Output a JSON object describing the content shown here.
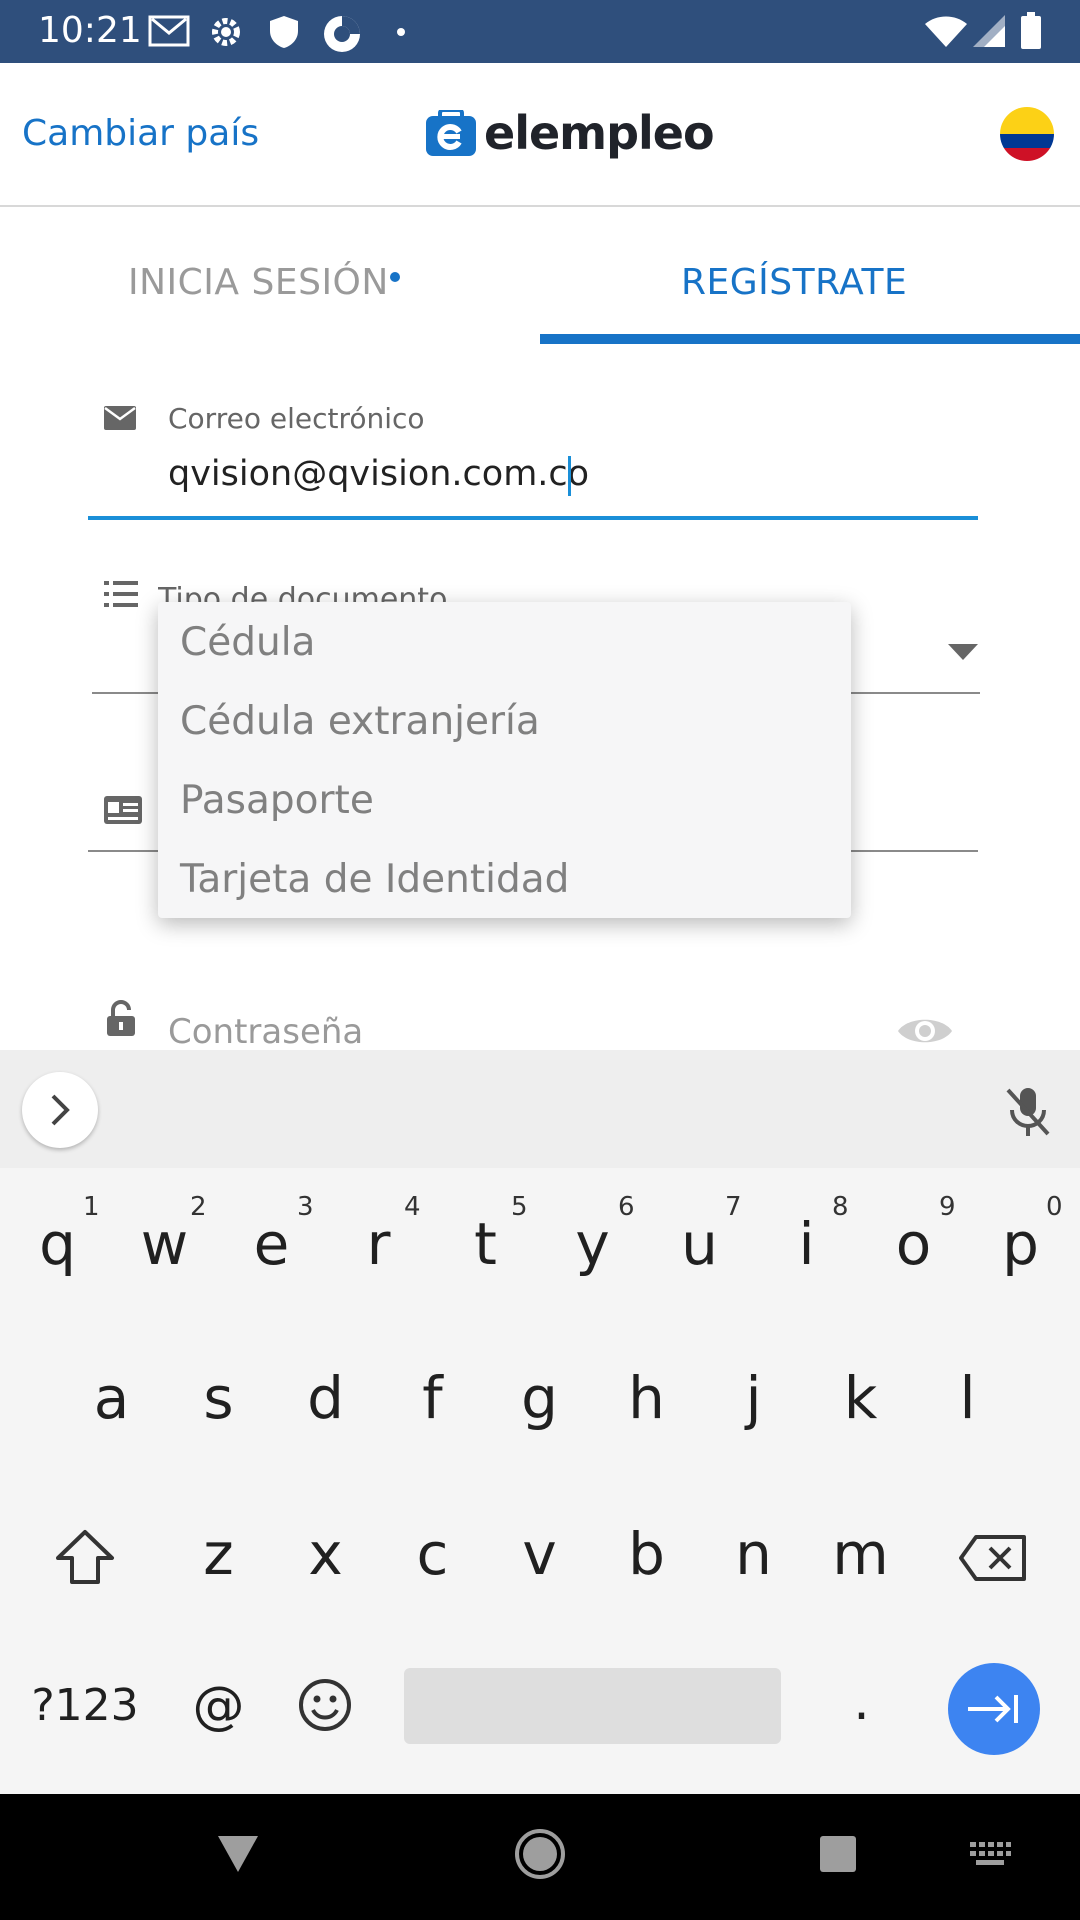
{
  "status_bar": {
    "time": "10:21"
  },
  "header": {
    "change_country": "Cambiar país",
    "logo_text": "elempleo"
  },
  "tabs": [
    {
      "label": "INICIA SESIÓN"
    },
    {
      "label": "REGÍSTRATE"
    }
  ],
  "form": {
    "email": {
      "label": "Correo electrónico",
      "value": "qvision@qvision.com.co"
    },
    "document_type": {
      "label": "Tipo de documento",
      "options": [
        "Cédula",
        "Cédula extranjería",
        "Pasaporte",
        "Tarjeta de Identidad"
      ]
    },
    "password": {
      "placeholder": "Contraseña"
    }
  },
  "keyboard": {
    "row1": [
      "q",
      "w",
      "e",
      "r",
      "t",
      "y",
      "u",
      "i",
      "o",
      "p"
    ],
    "row1_hints": [
      "1",
      "2",
      "3",
      "4",
      "5",
      "6",
      "7",
      "8",
      "9",
      "0"
    ],
    "row2": [
      "a",
      "s",
      "d",
      "f",
      "g",
      "h",
      "j",
      "k",
      "l"
    ],
    "row3": [
      "z",
      "x",
      "c",
      "v",
      "b",
      "n",
      "m"
    ],
    "symbols_key": "?123",
    "at_key": "@",
    "period_key": "."
  },
  "colors": {
    "accent": "#1773c7",
    "status_bar": "#2f4f7c",
    "focus": "#1a8fd8",
    "enter_key": "#3d84f1"
  }
}
